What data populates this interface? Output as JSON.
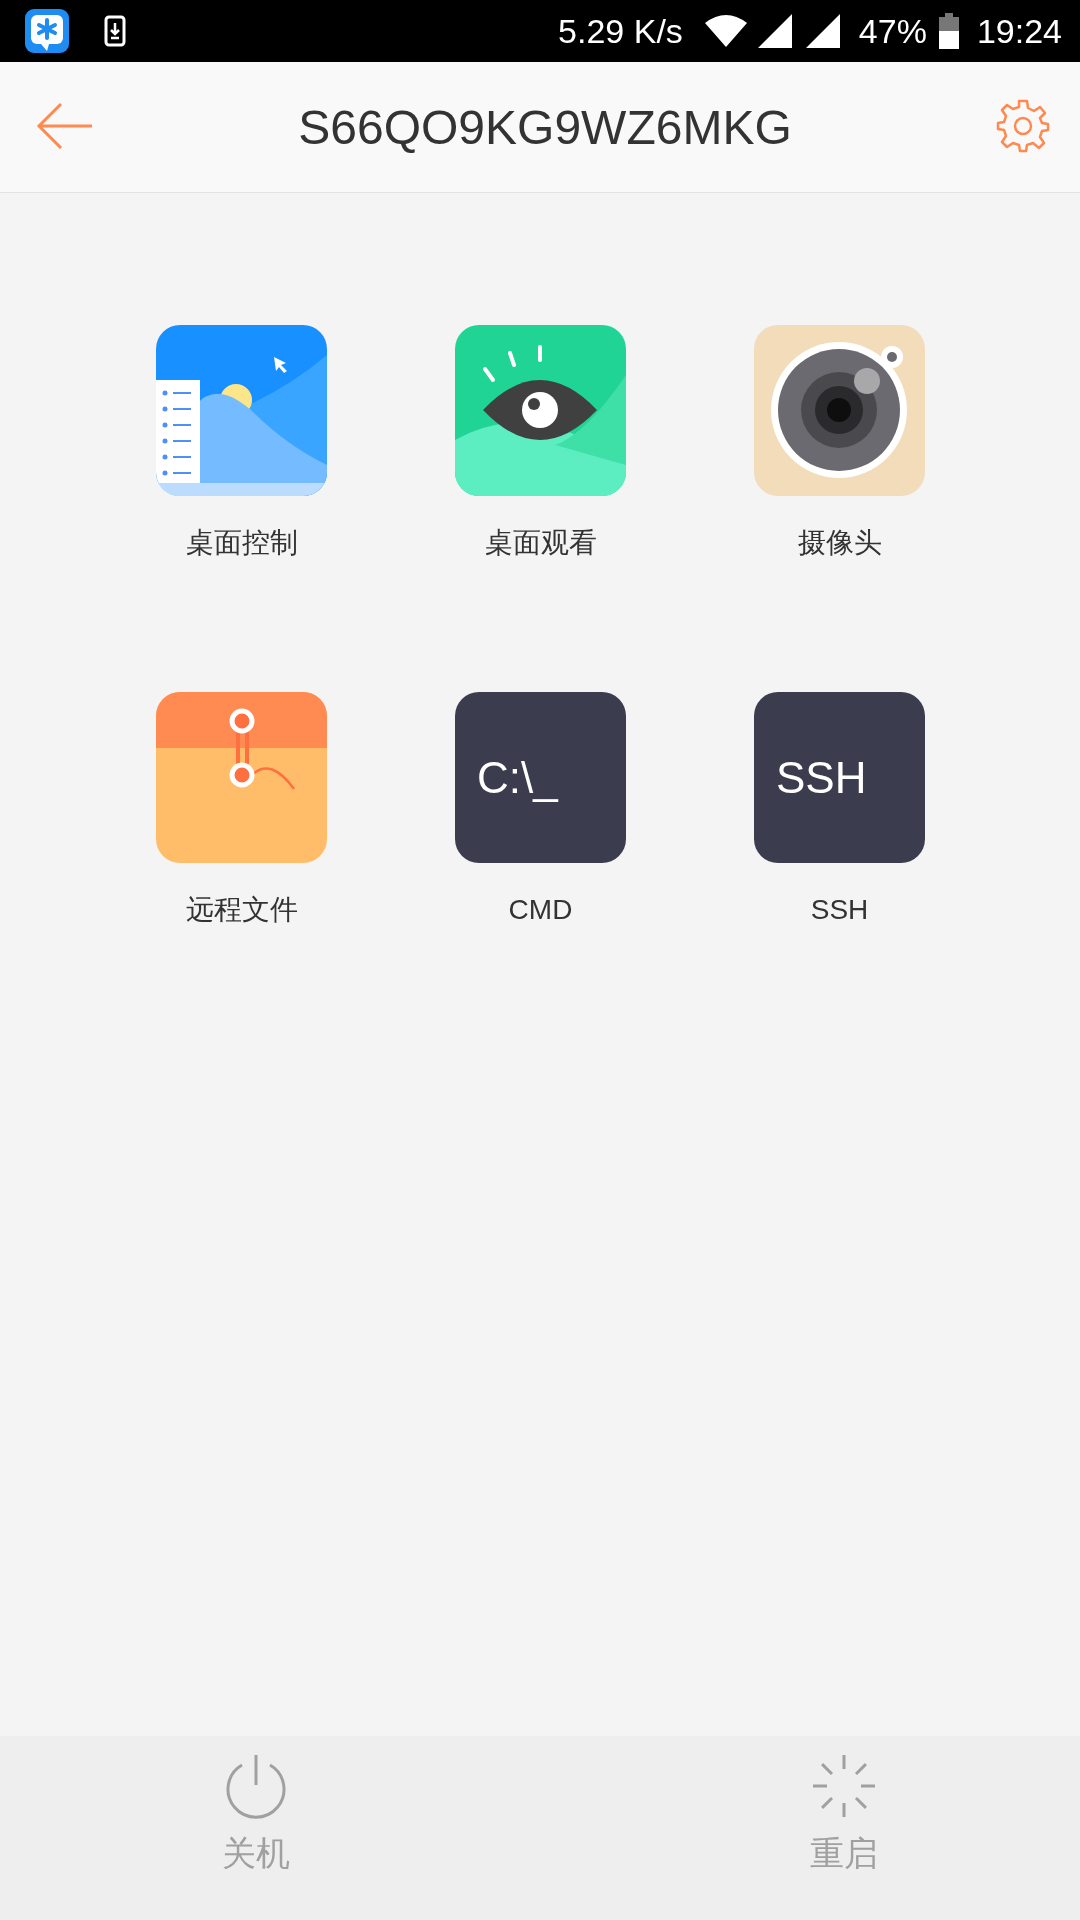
{
  "status_bar": {
    "net_speed": "5.29 K/s",
    "battery": "47%",
    "time": "19:24"
  },
  "header": {
    "title": "S66QO9KG9WZ6MKG"
  },
  "tiles": [
    {
      "kind": "desktop",
      "label": "桌面控制"
    },
    {
      "kind": "eye",
      "label": "桌面观看"
    },
    {
      "kind": "camera",
      "label": "摄像头"
    },
    {
      "kind": "folder",
      "label": "远程文件"
    },
    {
      "kind": "terminal",
      "tile_text": "C:\\_",
      "label": "CMD"
    },
    {
      "kind": "terminal",
      "tile_text": "SSH",
      "label": "SSH"
    }
  ],
  "actions": [
    {
      "kind": "power",
      "label": "关机"
    },
    {
      "kind": "restart",
      "label": "重启"
    }
  ]
}
